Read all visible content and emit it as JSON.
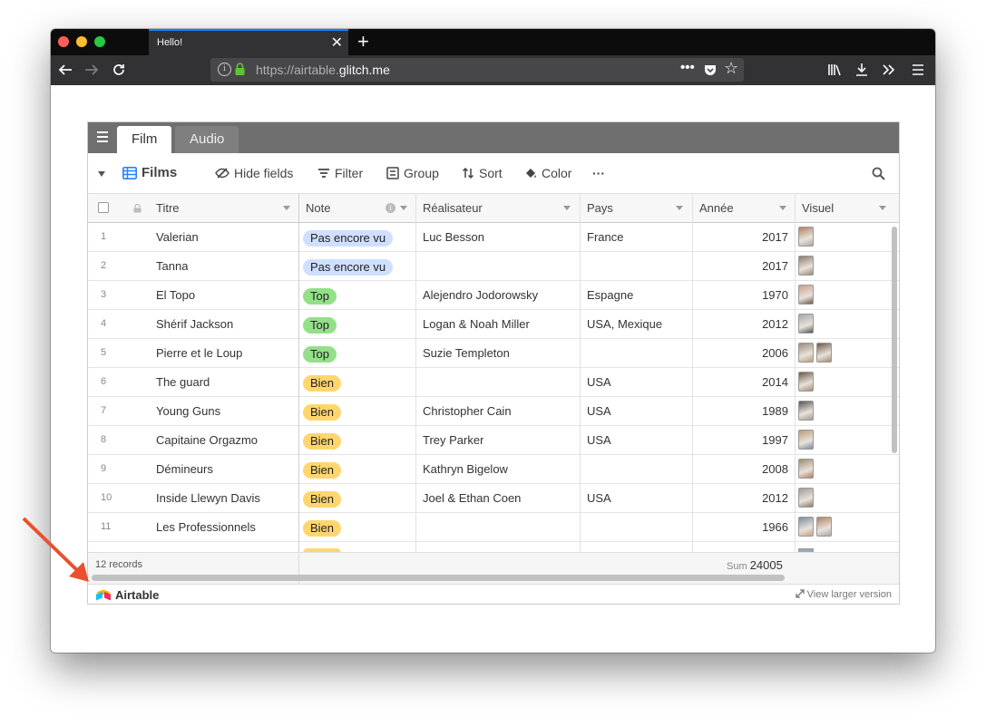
{
  "browser": {
    "tab_title": "Hello!",
    "url_prefix": "https://airtable.",
    "url_domain": "glitch.me"
  },
  "tables": {
    "active": "Film",
    "inactive": "Audio"
  },
  "toolbar": {
    "view_name": "Films",
    "hide_fields": "Hide fields",
    "filter": "Filter",
    "group": "Group",
    "sort": "Sort",
    "color": "Color",
    "more": "···"
  },
  "columns": [
    "Titre",
    "Note",
    "Réalisateur",
    "Pays",
    "Année",
    "Visuel"
  ],
  "rows": [
    {
      "n": "1",
      "titre": "Valerian",
      "note": "Pas encore vu",
      "realisateur": "Luc Besson",
      "pays": "France",
      "annee": "2017",
      "visuel": 1
    },
    {
      "n": "2",
      "titre": "Tanna",
      "note": "Pas encore vu",
      "realisateur": "",
      "pays": "",
      "annee": "2017",
      "visuel": 1
    },
    {
      "n": "3",
      "titre": "El Topo",
      "note": "Top",
      "realisateur": "Alejendro Jodorowsky",
      "pays": "Espagne",
      "annee": "1970",
      "visuel": 1
    },
    {
      "n": "4",
      "titre": "Shérif Jackson",
      "note": "Top",
      "realisateur": "Logan & Noah Miller",
      "pays": "USA, Mexique",
      "annee": "2012",
      "visuel": 1
    },
    {
      "n": "5",
      "titre": "Pierre et le Loup",
      "note": "Top",
      "realisateur": "Suzie Templeton",
      "pays": "",
      "annee": "2006",
      "visuel": 2
    },
    {
      "n": "6",
      "titre": "The guard",
      "note": "Bien",
      "realisateur": "",
      "pays": "USA",
      "annee": "2014",
      "visuel": 1
    },
    {
      "n": "7",
      "titre": "Young Guns",
      "note": "Bien",
      "realisateur": "Christopher Cain",
      "pays": "USA",
      "annee": "1989",
      "visuel": 1
    },
    {
      "n": "8",
      "titre": "Capitaine Orgazmo",
      "note": "Bien",
      "realisateur": "Trey Parker",
      "pays": "USA",
      "annee": "1997",
      "visuel": 1
    },
    {
      "n": "9",
      "titre": "Démineurs",
      "note": "Bien",
      "realisateur": "Kathryn Bigelow",
      "pays": "",
      "annee": "2008",
      "visuel": 1
    },
    {
      "n": "10",
      "titre": "Inside Llewyn Davis",
      "note": "Bien",
      "realisateur": "Joel & Ethan Coen",
      "pays": "USA",
      "annee": "2012",
      "visuel": 1
    },
    {
      "n": "11",
      "titre": "Les Professionnels",
      "note": "Bien",
      "realisateur": "",
      "pays": "",
      "annee": "1966",
      "visuel": 2
    }
  ],
  "footer": {
    "records": "12 records",
    "sum_label": "Sum",
    "sum_value": "24005",
    "brand": "Airtable",
    "view_larger": "View larger version"
  },
  "colors": {
    "pas_encore_vu": "#cfdfff",
    "top": "#93e088",
    "bien": "#ffd66e",
    "annotation_arrow": "#e8502f"
  }
}
